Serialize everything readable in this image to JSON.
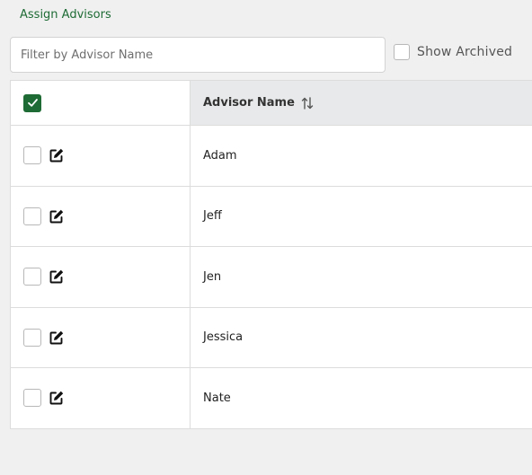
{
  "header": {
    "title_link": "Assign Advisors"
  },
  "filter": {
    "placeholder": "Filter by Advisor Name",
    "value": ""
  },
  "show_archived": {
    "label": "Show Archived",
    "checked": false
  },
  "table": {
    "columns": [
      {
        "label": "Advisor Name",
        "sort_icon": "sort-arrows-icon"
      }
    ],
    "select_all_checked": true,
    "rows": [
      {
        "name": "Adam",
        "checked": false
      },
      {
        "name": "Jeff",
        "checked": false
      },
      {
        "name": "Jen",
        "checked": false
      },
      {
        "name": "Jessica",
        "checked": false
      },
      {
        "name": "Nate",
        "checked": false
      }
    ]
  },
  "colors": {
    "accent": "#1e6b35",
    "header_bg": "#e8e9ea",
    "page_bg": "#f0f0f0"
  }
}
